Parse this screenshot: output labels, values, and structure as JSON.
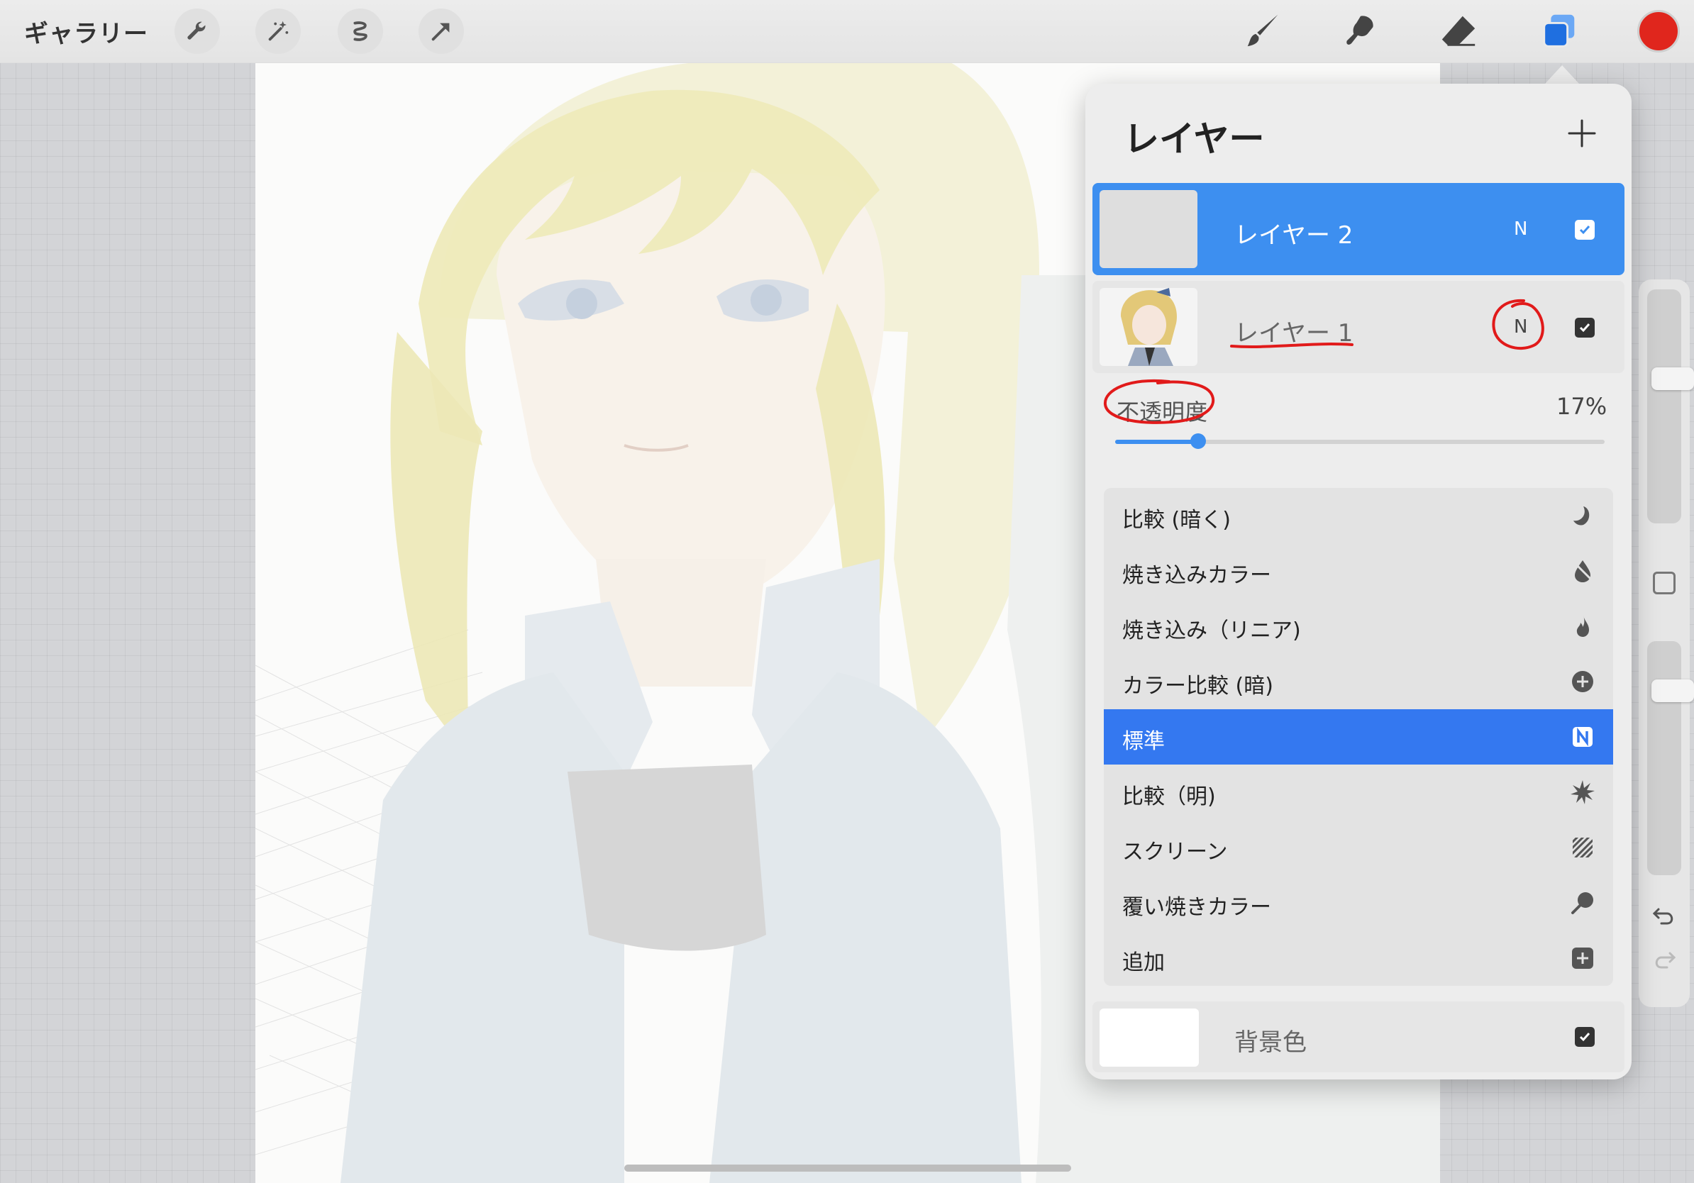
{
  "toolbar": {
    "gallery_label": "ギャラリー",
    "left_tools": [
      "wrench-icon",
      "magic-wand-icon",
      "selection-icon",
      "transform-arrow-icon"
    ],
    "right_tools": [
      "brush-icon",
      "smudge-icon",
      "eraser-icon",
      "layers-icon"
    ],
    "current_color": "#e0261d"
  },
  "layers_panel": {
    "title": "レイヤー",
    "add_icon": "plus-icon",
    "layers": [
      {
        "name": "レイヤー 2",
        "blend": "N",
        "visible": true,
        "active": true
      },
      {
        "name": "レイヤー 1",
        "blend": "N",
        "visible": true,
        "active": false
      }
    ],
    "opacity": {
      "label": "不透明度",
      "value_text": "17%",
      "value": 0.17
    },
    "blend_modes": [
      {
        "label": "比較 (暗く)",
        "icon": "moon-icon",
        "selected": false
      },
      {
        "label": "焼き込みカラー",
        "icon": "burn-drop-icon",
        "selected": false
      },
      {
        "label": "焼き込み（リニア)",
        "icon": "flame-icon",
        "selected": false
      },
      {
        "label": "カラー比較 (暗)",
        "icon": "plus-circle-icon",
        "selected": false
      },
      {
        "label": "標準",
        "icon": "n-badge-icon",
        "selected": true
      },
      {
        "label": "比較（明)",
        "icon": "sun-burst-icon",
        "selected": false
      },
      {
        "label": "スクリーン",
        "icon": "stripes-icon",
        "selected": false
      },
      {
        "label": "覆い焼きカラー",
        "icon": "dodge-icon",
        "selected": false
      },
      {
        "label": "追加",
        "icon": "plus-square-icon",
        "selected": false
      }
    ],
    "background": {
      "name": "背景色",
      "visible": true
    }
  },
  "sidebar": {
    "brush_size": 0.37,
    "brush_opacity": 0.82
  },
  "colors": {
    "accent": "#3d8ff0",
    "selected_mode": "#3478f0",
    "annotation": "#e11a1a"
  }
}
